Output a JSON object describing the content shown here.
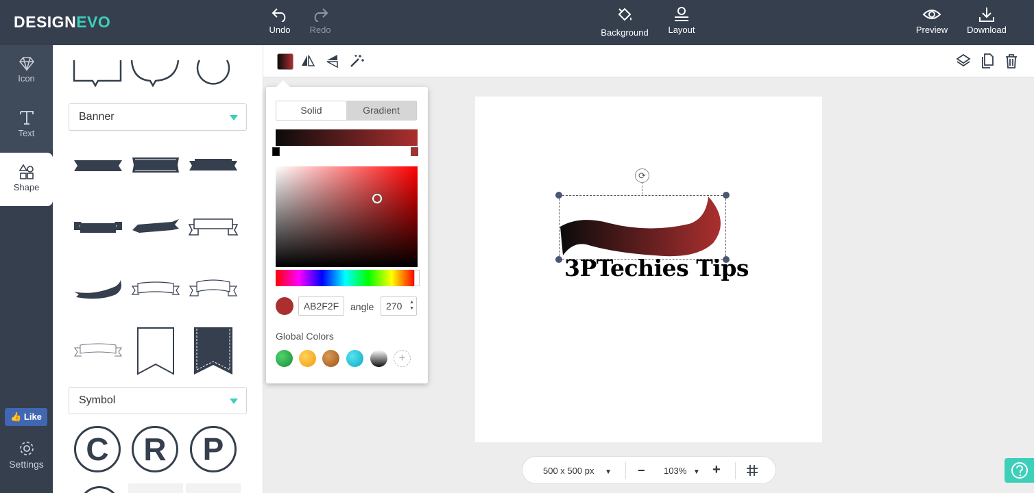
{
  "app": {
    "logo_part1": "DESIGN",
    "logo_part2": "EVO"
  },
  "topbar": {
    "undo": "Undo",
    "redo": "Redo",
    "background": "Background",
    "layout": "Layout",
    "preview": "Preview",
    "download": "Download"
  },
  "rail": {
    "items": [
      {
        "label": "Icon",
        "icon": "diamond-icon"
      },
      {
        "label": "Text",
        "icon": "text-t-icon"
      },
      {
        "label": "Shape",
        "icon": "shapes-icon",
        "active": true
      }
    ],
    "like": "Like",
    "settings": "Settings"
  },
  "panel": {
    "banner_select": "Banner",
    "symbol_select": "Symbol",
    "symbols": [
      "C",
      "R",
      "P"
    ]
  },
  "canvas": {
    "text": "3PTechies Tips",
    "rotate_glyph": "⟳"
  },
  "color_popover": {
    "tabs": [
      "Solid",
      "Gradient"
    ],
    "active_tab": "Gradient",
    "gradient_start": "#0b0b0b",
    "gradient_end": "#ab2f2f",
    "hex_value": "AB2F2F",
    "angle_label": "angle",
    "angle_value": "270",
    "global_colors_label": "Global Colors",
    "global_colors": [
      "#28a745",
      "#f7a928",
      "#b8691f",
      "#17c1d8",
      "#222222"
    ],
    "add_glyph": "+"
  },
  "bottom_bar": {
    "size": "500 x 500 px",
    "zoom": "103%",
    "minus": "−",
    "plus": "+"
  },
  "colors": {
    "accent": "#3ecfba",
    "dark": "#353f4e"
  }
}
